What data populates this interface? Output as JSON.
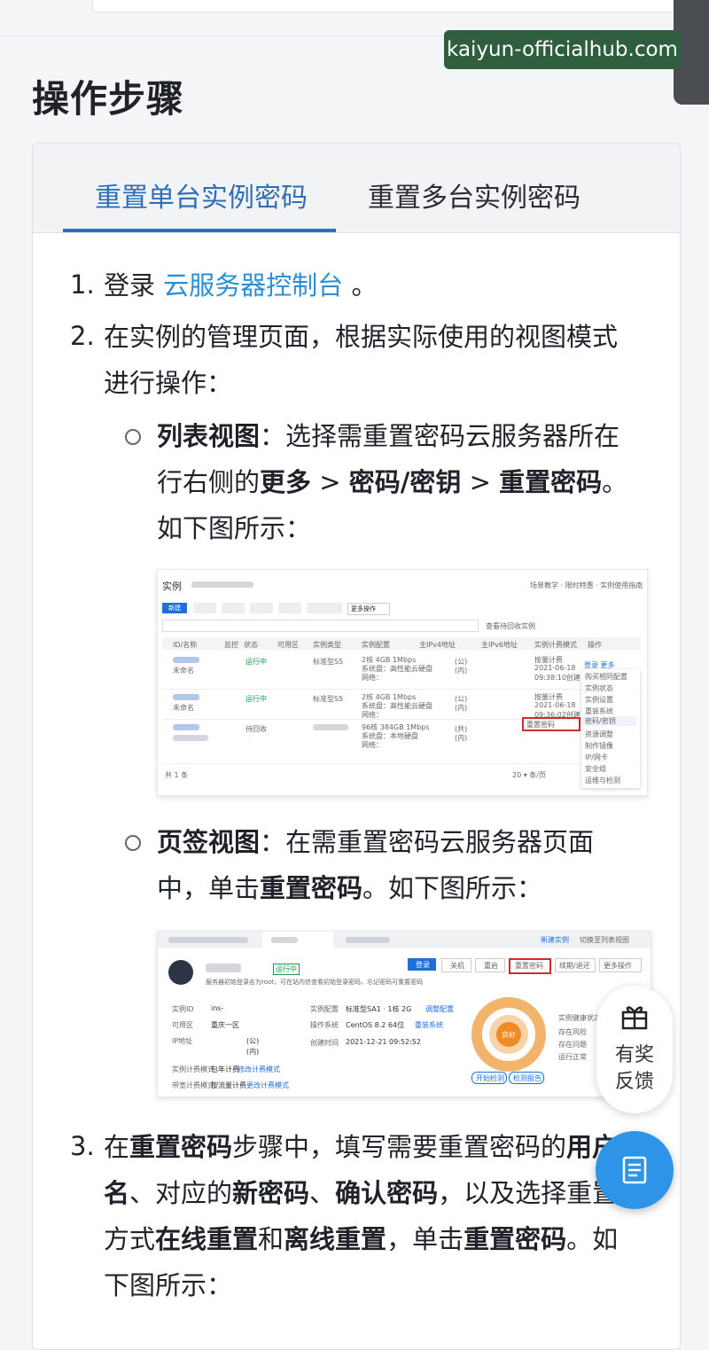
{
  "watermark": "kaiyun-officialhub.com",
  "heading": "操作步骤",
  "tabs": [
    {
      "label": "重置单台实例密码",
      "active": true
    },
    {
      "label": "重置多台实例密码",
      "active": false
    }
  ],
  "steps": {
    "s1_num": "1.",
    "s1_a": "登录",
    "s1_link": "云服务器控制台",
    "s1_b": "。",
    "s2_num": "2.",
    "s2_line1": "在实例的管理页面，根据实际使用的视图模式",
    "s2_line2": "进行操作：",
    "sub1_b": "列表视图",
    "sub1_a": "：选择需重置密码云服务器所在",
    "sub1_line2a": "行右侧的",
    "sub1_more": "更多",
    "sub1_gt1": " > ",
    "sub1_pk": "密码/密钥",
    "sub1_gt2": " > ",
    "sub1_reset": "重置密码",
    "sub1_end": "。",
    "sub1_line3": "如下图所示：",
    "sub2_b": "页签视图",
    "sub2_a": "：在需重置密码云服务器页面",
    "sub2_line2a": "中，单击",
    "sub2_reset": "重置密码",
    "sub2_line2b": "。如下图所示：",
    "s3_num": "3.",
    "s3_l1a": "在",
    "s3_l1b": "重置密码",
    "s3_l1c": "步骤中，填写需要重置密码的",
    "s3_l1d": "用户",
    "s3_l2a": "名",
    "s3_l2b": "、对应的",
    "s3_l2c": "新密码",
    "s3_l2d": "、",
    "s3_l2e": "确认密码",
    "s3_l2f": "，以及选择重置",
    "s3_l3a": "方式",
    "s3_l3b": "在线重置",
    "s3_l3c": "和",
    "s3_l3d": "离线重置",
    "s3_l3e": "，单击",
    "s3_l3f": "重置密码",
    "s3_l3g": "。如",
    "s3_l4": "下图所示："
  },
  "screenshot1": {
    "title": "实例",
    "new_btn": "新建",
    "more_ops": "更多操作",
    "view_recycle": "查看待回收实例",
    "headers": [
      "ID/名称",
      "监控",
      "状态",
      "可用区",
      "实例类型",
      "实例配置",
      "主IPv4地址",
      "主IPv6地址",
      "实例计费模式",
      "操作"
    ],
    "rows": [
      {
        "name": "未命名",
        "status": "运行中",
        "type": "标准型S5",
        "config": "2核 4GB 1Mbps",
        "disk": "系统盘：高性能云硬盘",
        "net": "网络：",
        "ip_pub": "(公)",
        "ip_in": "(内)",
        "billing": "按量计费",
        "date": "2021-06-18",
        "time": "09:38:10创建",
        "ops": "登录 更多"
      },
      {
        "name": "未命名",
        "status": "运行中",
        "type": "标准型S5",
        "config": "2核 4GB 1Mbps",
        "disk": "系统盘：高性能云硬盘",
        "net": "网络：",
        "ip_pub": "(公)",
        "ip_in": "(内)",
        "billing": "按量计费",
        "date": "2021-06-18",
        "time": "09:36:02创建",
        "ops": ""
      },
      {
        "name": "",
        "status": "待回收",
        "type": "",
        "config": "96核 384GB 1Mbps",
        "disk": "系统盘：本地硬盘",
        "net": "网络：",
        "ip_pub": "(共)",
        "ip_in": "(内)",
        "billing": "",
        "date": "",
        "time": "",
        "ops": ""
      }
    ],
    "total": "共 1 条",
    "page_size": "20 ▾ 条/页",
    "reset_highlight": "重置密码",
    "menu": [
      "购买相同配置",
      "实例状态",
      "实例设置",
      "重装系统",
      "密码/密钥",
      "资源调整",
      "制作镜像",
      "IP/网卡",
      "安全组",
      "运维与检测"
    ]
  },
  "screenshot2": {
    "new_instance": "新建实例",
    "switch_list": "切换至列表视图",
    "status": "运行中",
    "hint": "服务器初始登录名为root，可在站内信查看初始登录密码，忘记密码可重置密码",
    "buttons": [
      "登录",
      "关机",
      "重启",
      "重置密码",
      "续期/退还",
      "更多操作"
    ],
    "fields": [
      {
        "label": "实例ID",
        "value": "ins-"
      },
      {
        "label": "可用区",
        "value": "重庆一区"
      },
      {
        "label": "IP地址",
        "value": "(公)"
      },
      {
        "label": "",
        "value": "(内)"
      },
      {
        "label": "实例计费模式",
        "value": "包年计费",
        "link": "修改计费模式"
      },
      {
        "label": "带宽计费模式",
        "value": "按流量计费",
        "link": "更改计费模式"
      }
    ],
    "fields2": [
      {
        "label": "实例配置",
        "value": "标准型SA1 · 1核 2G",
        "link": "调整配置"
      },
      {
        "label": "操作系统",
        "value": "CentOS 8.2 64位",
        "link": "重装系统"
      },
      {
        "label": "创建时间",
        "value": "2021-12-21 09:52:52"
      }
    ],
    "health": "实例健康状态",
    "gauge_center": "良好",
    "start_check": "开始检测",
    "check_report": "检测报告",
    "side_labels": [
      "存在风险",
      "存在问题",
      "运行正常"
    ]
  },
  "feedback": {
    "line1": "有奖",
    "line2": "反馈"
  },
  "colors": {
    "accent": "#2f6fb5",
    "link": "#2b8fd6",
    "fab": "#2d94e8"
  }
}
